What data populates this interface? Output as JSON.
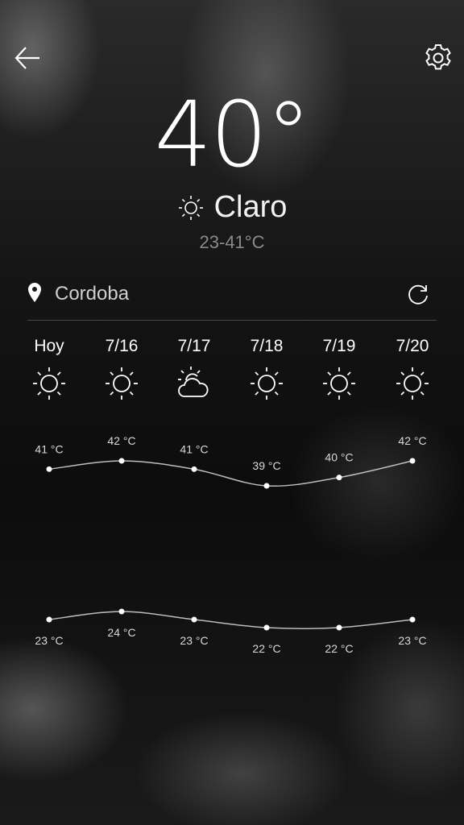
{
  "header": {
    "back_icon": "arrow-left-icon",
    "settings_icon": "gear-icon"
  },
  "current": {
    "temperature": "40°",
    "condition_icon": "sun-icon",
    "condition": "Claro",
    "range": "23-41°C"
  },
  "location": {
    "pin_icon": "map-pin-icon",
    "name": "Cordoba",
    "refresh_icon": "refresh-icon"
  },
  "forecast": [
    {
      "label": "Hoy",
      "icon": "sun-icon"
    },
    {
      "label": "7/16",
      "icon": "sun-icon"
    },
    {
      "label": "7/17",
      "icon": "partly-cloudy-icon"
    },
    {
      "label": "7/18",
      "icon": "sun-icon"
    },
    {
      "label": "7/19",
      "icon": "sun-icon"
    },
    {
      "label": "7/20",
      "icon": "sun-icon"
    }
  ],
  "chart_data": {
    "type": "line",
    "categories": [
      "Hoy",
      "7/16",
      "7/17",
      "7/18",
      "7/19",
      "7/20"
    ],
    "series": [
      {
        "values": [
          41,
          42,
          41,
          39,
          40,
          42
        ],
        "labels": [
          "41 °C",
          "42 °C",
          "41 °C",
          "39 °C",
          "40 °C",
          "42 °C"
        ]
      },
      {
        "values": [
          23,
          24,
          23,
          22,
          22,
          23
        ],
        "labels": [
          "23 °C",
          "24 °C",
          "23 °C",
          "22 °C",
          "22 °C",
          "23 °C"
        ]
      }
    ],
    "grid": false,
    "colors": {
      "line": "#bdbdbd",
      "point": "#ffffff"
    }
  }
}
